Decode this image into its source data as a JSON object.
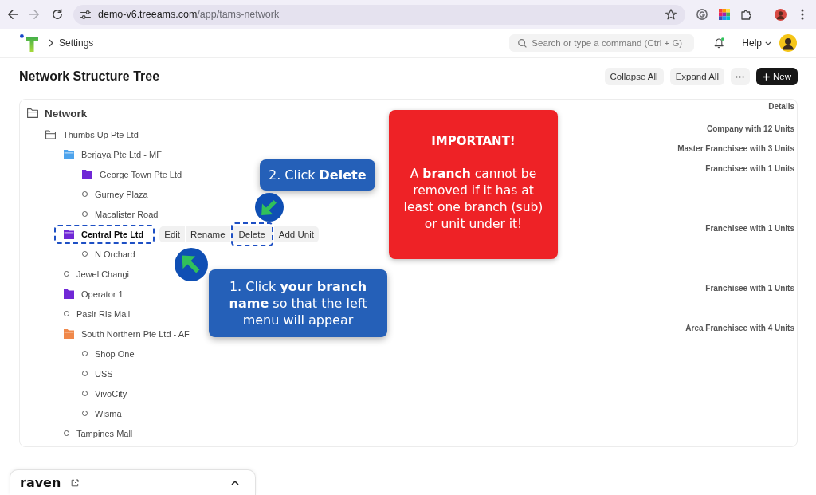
{
  "browser": {
    "url_host": "demo-v6.treeams.com",
    "url_path": "/app/tams-network"
  },
  "header": {
    "breadcrumb": "Settings",
    "search": {
      "placeholder": "Search or type a command (Ctrl + G)"
    },
    "help": "Help"
  },
  "page": {
    "title": "Network Structure Tree",
    "buttons": [
      {
        "kind": "secondary",
        "label": "Collapse All"
      },
      {
        "kind": "secondary",
        "label": "Expand All"
      },
      {
        "kind": "more"
      },
      {
        "kind": "primary",
        "label": "New"
      }
    ]
  },
  "tree": {
    "details_heading": "Details",
    "root": {
      "kind": "root",
      "label": "Network",
      "expanded": true,
      "selected": false,
      "highlighted": false,
      "children": [
        {
          "kind": "company",
          "label": "Thumbs Up Pte Ltd",
          "details": "Company with 12 Units",
          "expanded": true,
          "selected": false,
          "highlighted": false,
          "children": [
            {
              "kind": "branch",
              "label": "Berjaya Pte Ltd - MF",
              "color": "#4da3ec",
              "details": "Master Franchisee with 3 Units",
              "expanded": true,
              "selected": false,
              "highlighted": false,
              "children": [
                {
                  "kind": "branch",
                  "label": "George Town Pte Ltd",
                  "color": "#7028d6",
                  "details": "Franchisee with 1 Units",
                  "expanded": false,
                  "selected": false,
                  "highlighted": false
                },
                {
                  "kind": "unit",
                  "label": "Gurney Plaza",
                  "selected": false,
                  "highlighted": false
                },
                {
                  "kind": "unit",
                  "label": "Macalister Road",
                  "selected": false,
                  "highlighted": false
                }
              ]
            },
            {
              "kind": "branch",
              "label": "Central Pte Ltd",
              "color": "#7028d6",
              "details": "Franchisee with 1 Units",
              "expanded": true,
              "selected": true,
              "highlighted": true,
              "actions": [
                {
                  "label": "Edit",
                  "highlighted": false
                },
                {
                  "label": "Rename",
                  "highlighted": false
                },
                {
                  "label": "Delete",
                  "highlighted": true
                },
                {
                  "label": "Add Unit",
                  "highlighted": false
                }
              ],
              "children": [
                {
                  "kind": "unit",
                  "label": "N Orchard",
                  "selected": false,
                  "highlighted": false
                }
              ]
            },
            {
              "kind": "unit",
              "label": "Jewel Changi",
              "selected": false,
              "highlighted": false
            },
            {
              "kind": "branch",
              "label": "Operator 1",
              "color": "#7028d6",
              "details": "Franchisee with 1 Units",
              "expanded": false,
              "selected": false,
              "highlighted": false
            },
            {
              "kind": "unit",
              "label": "Pasir Ris Mall",
              "selected": false,
              "highlighted": false
            },
            {
              "kind": "branch",
              "label": "South Northern Pte Ltd - AF",
              "color": "#f0884a",
              "details": "Area Franchisee with 4 Units",
              "expanded": true,
              "selected": false,
              "highlighted": false,
              "children": [
                {
                  "kind": "unit",
                  "label": "Shop One",
                  "selected": false,
                  "highlighted": false
                },
                {
                  "kind": "unit",
                  "label": "USS",
                  "selected": false,
                  "highlighted": false
                },
                {
                  "kind": "unit",
                  "label": "VivoCity",
                  "selected": false,
                  "highlighted": false
                },
                {
                  "kind": "unit",
                  "label": "Wisma",
                  "selected": false,
                  "highlighted": false
                }
              ]
            },
            {
              "kind": "unit",
              "label": "Tampines Mall",
              "selected": false,
              "highlighted": false
            }
          ]
        }
      ]
    }
  },
  "notice": {
    "title": "IMPORTANT!",
    "text": "A **branch** cannot be removed if it has at least one branch (sub) or unit under it!"
  },
  "callouts": [
    {
      "text": "2. Click **Delete**"
    },
    {
      "text": "1. Click **your branch name** so that the left menu will appear"
    }
  ],
  "chat_panel": {
    "title": "raven"
  }
}
